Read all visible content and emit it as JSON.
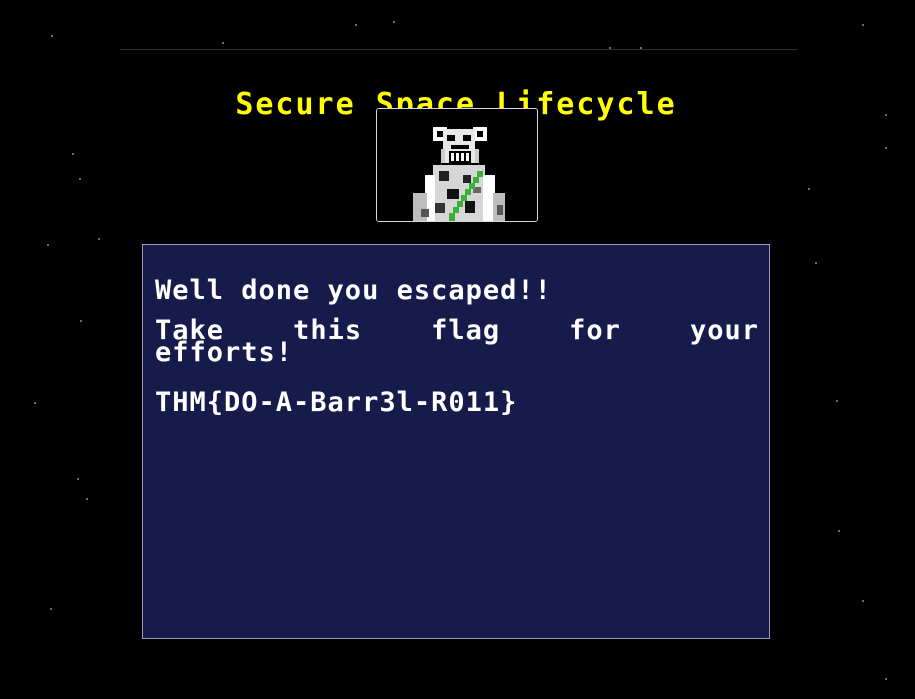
{
  "page": {
    "title": "Secure Space Lifecycle"
  },
  "avatar": {
    "icon": "pixel-bear-vader-icon"
  },
  "message": {
    "line1": "Well done you escaped!!",
    "line2": "Take this flag for your efforts!",
    "flag": "THM{DO-A-Barr3l-R011}"
  },
  "colors": {
    "background": "#000000",
    "title": "#ffff00",
    "panel": "#161b4c",
    "panel_border": "#9a9ab0",
    "text": "#ffffff",
    "avatar_accent": "#3ab03a"
  }
}
